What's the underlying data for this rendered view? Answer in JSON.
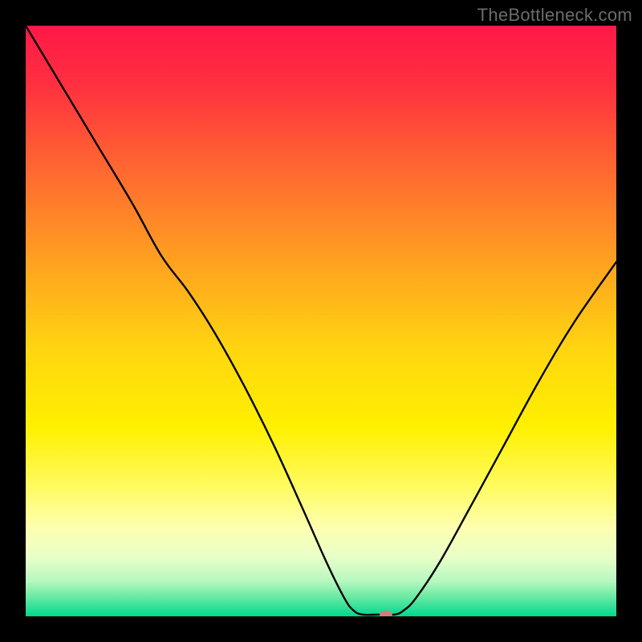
{
  "watermark": "TheBottleneck.com",
  "chart_data": {
    "type": "line",
    "title": "",
    "xlabel": "",
    "ylabel": "",
    "x_range": [
      0,
      100
    ],
    "y_range": [
      0,
      100
    ],
    "background_gradient": {
      "stops": [
        {
          "offset": 0.0,
          "color": "#ff1848"
        },
        {
          "offset": 0.1,
          "color": "#ff3040"
        },
        {
          "offset": 0.25,
          "color": "#ff6a30"
        },
        {
          "offset": 0.4,
          "color": "#ffa120"
        },
        {
          "offset": 0.55,
          "color": "#ffd610"
        },
        {
          "offset": 0.68,
          "color": "#fff000"
        },
        {
          "offset": 0.78,
          "color": "#fffb60"
        },
        {
          "offset": 0.85,
          "color": "#fdffb0"
        },
        {
          "offset": 0.9,
          "color": "#e8ffc8"
        },
        {
          "offset": 0.94,
          "color": "#b7f8c0"
        },
        {
          "offset": 0.97,
          "color": "#60e8a0"
        },
        {
          "offset": 1.0,
          "color": "#00d890"
        }
      ]
    },
    "curve": [
      {
        "x": 0.0,
        "y": 100.0
      },
      {
        "x": 6.0,
        "y": 90.0
      },
      {
        "x": 12.0,
        "y": 80.0
      },
      {
        "x": 18.0,
        "y": 70.0
      },
      {
        "x": 23.0,
        "y": 61.0
      },
      {
        "x": 27.5,
        "y": 55.0
      },
      {
        "x": 32.0,
        "y": 48.0
      },
      {
        "x": 37.0,
        "y": 39.0
      },
      {
        "x": 42.0,
        "y": 29.0
      },
      {
        "x": 47.0,
        "y": 18.0
      },
      {
        "x": 51.0,
        "y": 9.0
      },
      {
        "x": 54.0,
        "y": 3.0
      },
      {
        "x": 55.5,
        "y": 1.0
      },
      {
        "x": 57.0,
        "y": 0.3
      },
      {
        "x": 60.0,
        "y": 0.3
      },
      {
        "x": 62.5,
        "y": 0.3
      },
      {
        "x": 64.0,
        "y": 1.0
      },
      {
        "x": 66.0,
        "y": 3.0
      },
      {
        "x": 70.0,
        "y": 9.0
      },
      {
        "x": 75.0,
        "y": 18.0
      },
      {
        "x": 81.0,
        "y": 29.0
      },
      {
        "x": 87.0,
        "y": 40.0
      },
      {
        "x": 93.0,
        "y": 50.0
      },
      {
        "x": 100.0,
        "y": 60.0
      }
    ],
    "marker": {
      "x": 61.0,
      "y": 0.3,
      "color": "#d67a7a",
      "rx": 8,
      "ry": 5
    }
  }
}
